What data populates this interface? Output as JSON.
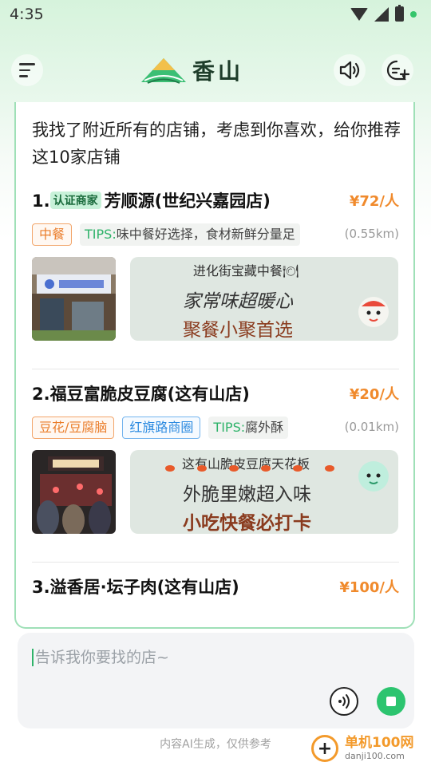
{
  "status_bar": {
    "time": "4:35"
  },
  "header": {
    "app_name": "香山"
  },
  "chat": {
    "intro": "我找了附近所有的店铺，考虑到你喜欢，给你推荐这10家店铺",
    "shops": [
      {
        "index": "1.",
        "badge": "认证商家",
        "name": "芳顺源(世纪兴嘉园店)",
        "price": "¥72/人",
        "tags": [
          {
            "label": "中餐",
            "style": "orange"
          }
        ],
        "tips_label": "TIPS:",
        "tips_text": "味中餐好选择，食材新鲜分量足",
        "distance": "(0.55km)",
        "banner_sub": "进化街宝藏中餐🍽",
        "banner_line1": "家常味超暖心",
        "banner_line2": "聚餐小聚首选"
      },
      {
        "index": "2.",
        "badge": "",
        "name": "福豆富脆皮豆腐(这有山店)",
        "price": "¥20/人",
        "tags": [
          {
            "label": "豆花/豆腐脑",
            "style": "orange"
          },
          {
            "label": "红旗路商圈",
            "style": "blue"
          }
        ],
        "tips_label": "TIPS:",
        "tips_text": "腐外酥",
        "distance": "(0.01km)",
        "banner_sub": "这有山脆皮豆腐天花板",
        "banner_line1": "外脆里嫩超入味",
        "banner_line2": "小吃快餐必打卡"
      },
      {
        "index": "3.",
        "badge": "",
        "name": "溢香居·坛子肉(这有山店)",
        "price": "¥100/人"
      }
    ]
  },
  "input": {
    "placeholder": "告诉我你要找的店~"
  },
  "footer": {
    "disclaimer": "内容AI生成，仅供参考"
  },
  "watermark": {
    "name": "单机100网",
    "url": "danji100.com"
  },
  "colors": {
    "accent_green": "#2cc46f",
    "price_orange": "#f08a2c"
  }
}
